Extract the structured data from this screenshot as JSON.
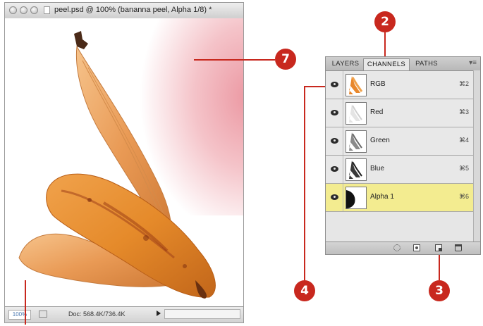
{
  "document_window": {
    "title": "peel.psd @ 100% (bananna peel, Alpha 1/8) *",
    "status": {
      "zoom": "100%",
      "doc_info": "Doc: 568.4K/736.4K"
    }
  },
  "channels_panel": {
    "tabs": [
      {
        "label": "LAYERS",
        "active": false
      },
      {
        "label": "CHANNELS",
        "active": true
      },
      {
        "label": "PATHS",
        "active": false
      }
    ],
    "channels": [
      {
        "name": "RGB",
        "shortcut": "⌘2",
        "visible": true,
        "selected": false
      },
      {
        "name": "Red",
        "shortcut": "⌘3",
        "visible": true,
        "selected": false
      },
      {
        "name": "Green",
        "shortcut": "⌘4",
        "visible": true,
        "selected": false
      },
      {
        "name": "Blue",
        "shortcut": "⌘5",
        "visible": true,
        "selected": false
      },
      {
        "name": "Alpha 1",
        "shortcut": "⌘6",
        "visible": true,
        "selected": true
      }
    ],
    "bottom_icons": [
      "load-selection-icon",
      "save-selection-icon",
      "new-channel-icon",
      "trash-icon"
    ]
  },
  "callouts": [
    {
      "number": "2"
    },
    {
      "number": "7"
    },
    {
      "number": "4"
    },
    {
      "number": "3"
    }
  ],
  "colors": {
    "callout": "#c8281e",
    "selected_row": "#f3ec90",
    "alpha_mask": "#e88692"
  }
}
